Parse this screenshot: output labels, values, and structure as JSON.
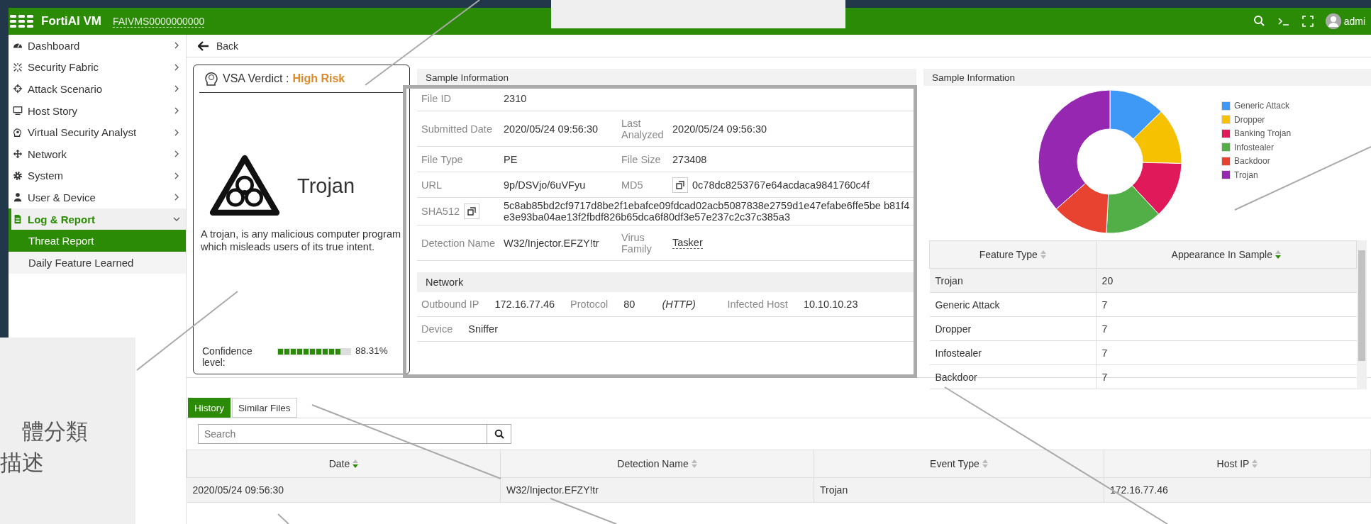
{
  "header": {
    "product": "FortiAI VM",
    "serial": "FAIVMS0000000000",
    "user": "admi"
  },
  "sidebar": {
    "items": [
      {
        "label": "Dashboard",
        "expanded": false
      },
      {
        "label": "Security Fabric",
        "expanded": false
      },
      {
        "label": "Attack Scenario",
        "expanded": false
      },
      {
        "label": "Host Story",
        "expanded": false
      },
      {
        "label": "Virtual Security Analyst",
        "expanded": false
      },
      {
        "label": "Network",
        "expanded": false
      },
      {
        "label": "System",
        "expanded": false
      },
      {
        "label": "User & Device",
        "expanded": false
      },
      {
        "label": "Log & Report",
        "expanded": true,
        "children": [
          {
            "label": "Threat Report",
            "selected": true
          },
          {
            "label": "Daily Feature Learned",
            "selected": false
          }
        ]
      }
    ]
  },
  "back": "Back",
  "verdict": {
    "label": "VSA Verdict :",
    "value": "High Risk",
    "category": "Trojan",
    "description": "A trojan, is any malicious computer program which misleads users of its true intent.",
    "confidence_label": "Confidence level:",
    "level": 0.8831,
    "reading": "88.31%"
  },
  "sample_info": {
    "title": "Sample Information",
    "rows": [
      {
        "fields": [
          {
            "label": "File ID",
            "value": "2310",
            "kind": "plain"
          }
        ]
      },
      {
        "fields": [
          {
            "label": "Submitted Date",
            "value": "2020/05/24 09:56:30",
            "kind": "plain"
          },
          {
            "label": "Last Analyzed",
            "value": "2020/05/24 09:56:30",
            "kind": "plain"
          }
        ]
      },
      {
        "fields": [
          {
            "label": "File Type",
            "value": "PE",
            "kind": "plain"
          },
          {
            "label": "File Size",
            "value": "273408",
            "kind": "plain"
          }
        ]
      },
      {
        "fields": [
          {
            "label": "URL",
            "value": "9p/DSVjo/6uVFyu",
            "kind": "plain"
          },
          {
            "label": "MD5",
            "value": "0c78dc8253767e64acdaca9841760c4f",
            "kind": "copy-value"
          }
        ]
      },
      {
        "fields": [
          {
            "label": "SHA512",
            "value": "5c8ab85bd2cf9717d8be2f1ebafce09fdcad02acb5087838e2759d1e47efabe6ffe5be b81f4e3e93ba04ae13f2fbdf826b65dca6f80df3e57e237c2c37c385a3",
            "kind": "copy-label"
          }
        ]
      },
      {
        "fields": [
          {
            "label": "Detection Name",
            "value": "W32/Injector.EFZY!tr",
            "kind": "plain"
          },
          {
            "label": "Virus Family",
            "value": "Tasker",
            "kind": "link"
          }
        ]
      }
    ],
    "network_title": "Network",
    "network_rows": [
      {
        "fields": [
          {
            "label": "Outbound IP",
            "value": "172.16.77.46"
          },
          {
            "label": "Protocol",
            "value": "80",
            "note": "(HTTP)"
          },
          {
            "label": "Infected Host",
            "value": "10.10.10.23"
          }
        ]
      },
      {
        "fields": [
          {
            "label": "Device",
            "value": "Sniffer"
          }
        ]
      }
    ]
  },
  "features": {
    "title": "Sample Information",
    "chart_data": {
      "type": "donut",
      "categories": [
        "Generic Attack",
        "Dropper",
        "Banking Trojan",
        "Infostealer",
        "Backdoor",
        "Trojan"
      ],
      "values": [
        12.7,
        12.7,
        12.7,
        12.7,
        12.7,
        36.5
      ],
      "colors": [
        "#3d99f5",
        "#f6c100",
        "#e0195a",
        "#52ae47",
        "#e84330",
        "#9527b0"
      ]
    },
    "columns": [
      {
        "label": "Feature Type",
        "sorted": false
      },
      {
        "label": "Appearance In Sample",
        "sorted": true
      }
    ],
    "rows": [
      {
        "cells": [
          "Trojan",
          "20"
        ],
        "selected": true
      },
      {
        "cells": [
          "Generic Attack",
          "7"
        ],
        "selected": false
      },
      {
        "cells": [
          "Dropper",
          "7"
        ],
        "selected": false
      },
      {
        "cells": [
          "Infostealer",
          "7"
        ],
        "selected": false
      },
      {
        "cells": [
          "Backdoor",
          "7"
        ],
        "selected": false
      }
    ]
  },
  "tabs": [
    {
      "label": "History",
      "selected": true
    },
    {
      "label": "Similar Files",
      "selected": false
    }
  ],
  "search": {
    "placeholder": "Search"
  },
  "history": {
    "columns": [
      {
        "label": "Date",
        "sorted": true
      },
      {
        "label": "Detection Name",
        "sorted": false
      },
      {
        "label": "Event Type",
        "sorted": false
      },
      {
        "label": "Host IP",
        "sorted": false
      }
    ],
    "rows": [
      {
        "cells": [
          "2020/05/24 09:56:30",
          "W32/Injector.EFZY!tr",
          "Trojan",
          "172.16.77.46"
        ],
        "selected": true
      }
    ]
  },
  "annotations": [
    {
      "lines": [
        "體分類",
        "描述"
      ]
    }
  ]
}
